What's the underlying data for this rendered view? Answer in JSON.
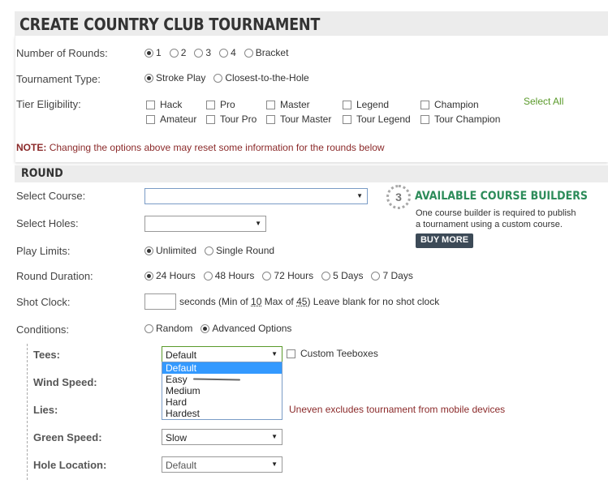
{
  "page": {
    "title": "CREATE COUNTRY CLUB TOURNAMENT"
  },
  "rounds": {
    "label": "Number of Rounds:",
    "options": [
      "1",
      "2",
      "3",
      "4",
      "Bracket"
    ],
    "selected": "1"
  },
  "tournament_type": {
    "label": "Tournament Type:",
    "options": [
      "Stroke Play",
      "Closest-to-the-Hole"
    ],
    "selected": "Stroke Play"
  },
  "tier": {
    "label": "Tier Eligibility:",
    "select_all": "Select All",
    "row1": [
      "Hack",
      "Pro",
      "Master",
      "Legend",
      "Champion"
    ],
    "row2": [
      "Amateur",
      "Tour Pro",
      "Tour Master",
      "Tour Legend",
      "Tour Champion"
    ]
  },
  "note": {
    "prefix": "NOTE:",
    "text": "Changing the options above may reset some information for the rounds below"
  },
  "round": {
    "title": "ROUND",
    "select_course_label": "Select Course:",
    "select_course_value": "",
    "select_holes_label": "Select Holes:",
    "select_holes_value": "",
    "play_limits": {
      "label": "Play Limits:",
      "options": [
        "Unlimited",
        "Single Round"
      ],
      "selected": "Unlimited"
    },
    "duration": {
      "label": "Round Duration:",
      "options": [
        "24 Hours",
        "48 Hours",
        "72 Hours",
        "5 Days",
        "7 Days"
      ],
      "selected": "24 Hours"
    },
    "shot_clock": {
      "label": "Shot Clock:",
      "value": "",
      "hint_a": "seconds (Min of ",
      "min": "10",
      "hint_b": " Max of ",
      "max": "45",
      "hint_c": ") Leave blank for no shot clock"
    },
    "conditions": {
      "label": "Conditions:",
      "options": [
        "Random",
        "Advanced Options"
      ],
      "selected": "Advanced Options"
    },
    "tees": {
      "label": "Tees:",
      "value": "Default",
      "custom_label": "Custom Teeboxes",
      "dropdown_options": [
        "Default",
        "Easy",
        "Medium",
        "Hard",
        "Hardest"
      ],
      "highlighted": "Default"
    },
    "wind_speed": {
      "label": "Wind Speed:"
    },
    "lies": {
      "label": "Lies:",
      "warning": "Uneven excludes tournament from mobile devices"
    },
    "green_speed": {
      "label": "Green Speed:",
      "value": "Slow"
    },
    "hole_location": {
      "label": "Hole Location:",
      "value": "Default"
    }
  },
  "builders": {
    "count": "3",
    "title": "AVAILABLE COURSE BUILDERS",
    "line1": "One course builder is required to publish",
    "line2": "a tournament using a custom course.",
    "button": "BUY MORE"
  },
  "colors": {
    "note": "#8b2a2a",
    "builders_title": "#2d8c5a",
    "select_all": "#5a9a2a",
    "dropdown_highlight": "#3399ff",
    "buy_button": "#3c4a57"
  }
}
